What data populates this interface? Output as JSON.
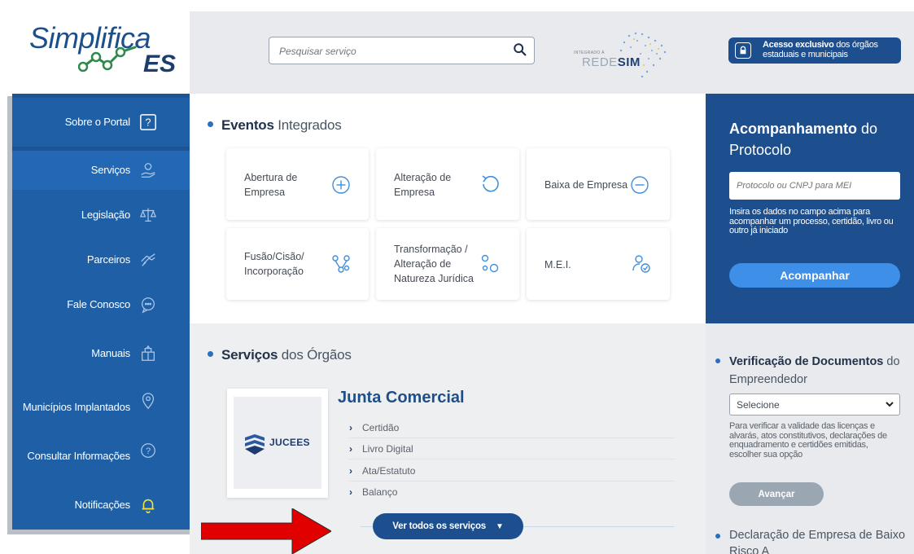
{
  "logo": {
    "text": "Simplifica",
    "suffix": "ES"
  },
  "search": {
    "placeholder": "Pesquisar serviço"
  },
  "redesim": {
    "small": "INTEGRADO À",
    "big_light": "REDE",
    "big_bold": "SIM"
  },
  "access": {
    "bold": "Acesso exclusivo",
    "rest": " dos órgãos estaduais e municipais"
  },
  "sidebar": {
    "items": [
      {
        "label": "Sobre o Portal",
        "icon": "question-icon"
      },
      {
        "label": "Serviços",
        "icon": "hand-service-icon"
      },
      {
        "label": "Legislação",
        "icon": "scales-icon"
      },
      {
        "label": "Parceiros",
        "icon": "handshake-icon"
      },
      {
        "label": "Fale Conosco",
        "icon": "chat-icon"
      },
      {
        "label": "Manuais",
        "icon": "book-icon"
      },
      {
        "label": "Municípios Implantados",
        "icon": "location-pin-icon"
      },
      {
        "label": "Consultar Informações",
        "icon": "question-circle-icon"
      },
      {
        "label": "Notificações",
        "icon": "bell-icon"
      }
    ]
  },
  "eventos": {
    "title_bold": "Eventos",
    "title_rest": " Integrados",
    "cards": [
      {
        "label": "Abertura de Empresa",
        "icon": "plus-circle-icon"
      },
      {
        "label": "Alteração de Empresa",
        "icon": "undo-icon"
      },
      {
        "label": "Baixa de Empresa",
        "icon": "minus-circle-icon"
      },
      {
        "label": "Fusão/Cisão/ Incorporação",
        "icon": "merge-icon"
      },
      {
        "label": "Transformação / Alteração de Natureza Jurídica",
        "icon": "transform-icon"
      },
      {
        "label": "M.E.I.",
        "icon": "user-check-icon"
      }
    ]
  },
  "servicos": {
    "title_bold": "Serviços",
    "title_rest": " dos Órgãos",
    "org_name": "Junta Comercial",
    "org_logo_text": "JUCEES",
    "items": [
      "Certidão",
      "Livro Digital",
      "Ata/Estatuto",
      "Balanço"
    ],
    "ver_todos": "Ver todos os serviços"
  },
  "acompanhamento": {
    "title_bold": "Acompanhamento",
    "title_rest": " do Protocolo",
    "placeholder": "Protocolo ou CNPJ para MEI",
    "help": "Insira os dados no campo acima para acompanhar um processo, certidão, livro ou outro já iniciado",
    "button": "Acompanhar"
  },
  "verificacao": {
    "title_bold": "Verificação de Documentos",
    "title_rest": " do Empreendedor",
    "select_value": "Selecione",
    "help": "Para verificar a validade das licenças e alvarás, atos constitutivos, declarações de enquadramento e certidões emitidas, escolher sua opção",
    "button": "Avançar",
    "declaracao": "Declaração de Empresa de Baixo Risco A"
  },
  "colors": {
    "sidebar": "#1f5fa6",
    "dark_blue": "#1d4f8f",
    "accent": "#3d8fe8",
    "arrow": "#e00000"
  }
}
